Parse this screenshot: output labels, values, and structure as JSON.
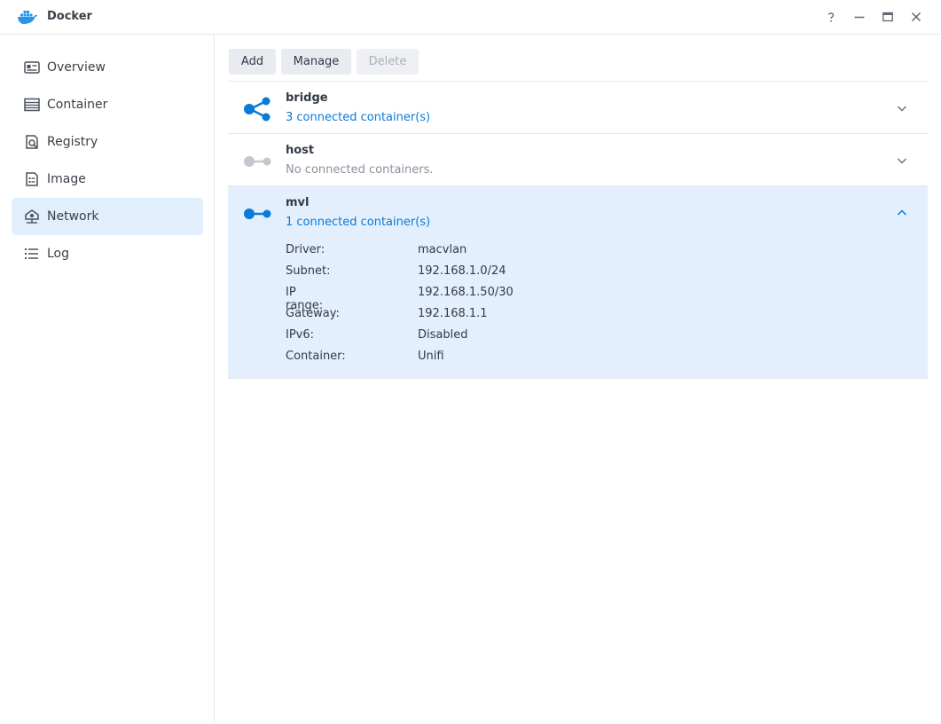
{
  "window": {
    "title": "Docker"
  },
  "sidebar": {
    "items": [
      {
        "label": "Overview",
        "icon": "overview-icon",
        "active": false
      },
      {
        "label": "Container",
        "icon": "container-icon",
        "active": false
      },
      {
        "label": "Registry",
        "icon": "registry-icon",
        "active": false
      },
      {
        "label": "Image",
        "icon": "image-icon",
        "active": false
      },
      {
        "label": "Network",
        "icon": "network-icon",
        "active": true
      },
      {
        "label": "Log",
        "icon": "log-icon",
        "active": false
      }
    ]
  },
  "toolbar": {
    "add_label": "Add",
    "manage_label": "Manage",
    "delete_label": "Delete"
  },
  "networks": [
    {
      "name": "bridge",
      "subtitle": "3 connected container(s)",
      "icon": "bridge-network-icon",
      "expanded": false
    },
    {
      "name": "host",
      "subtitle": "No connected containers.",
      "icon": "host-network-icon",
      "expanded": false
    },
    {
      "name": "mvl",
      "subtitle": "1 connected container(s)",
      "icon": "macvlan-network-icon",
      "expanded": true,
      "details": [
        {
          "key": "Driver:",
          "value": "macvlan"
        },
        {
          "key": "Subnet:",
          "value": "192.168.1.0/24"
        },
        {
          "key": "IP range:",
          "value": "192.168.1.50/30"
        },
        {
          "key": "Gateway:",
          "value": "192.168.1.1"
        },
        {
          "key": "IPv6:",
          "value": "Disabled"
        },
        {
          "key": "Container:",
          "value": "Unifi"
        }
      ]
    }
  ],
  "colors": {
    "accent": "#0a7ad9",
    "selected_bg": "#e3effc",
    "muted": "#8b929c",
    "disabled_icon": "#c4c8ce"
  }
}
